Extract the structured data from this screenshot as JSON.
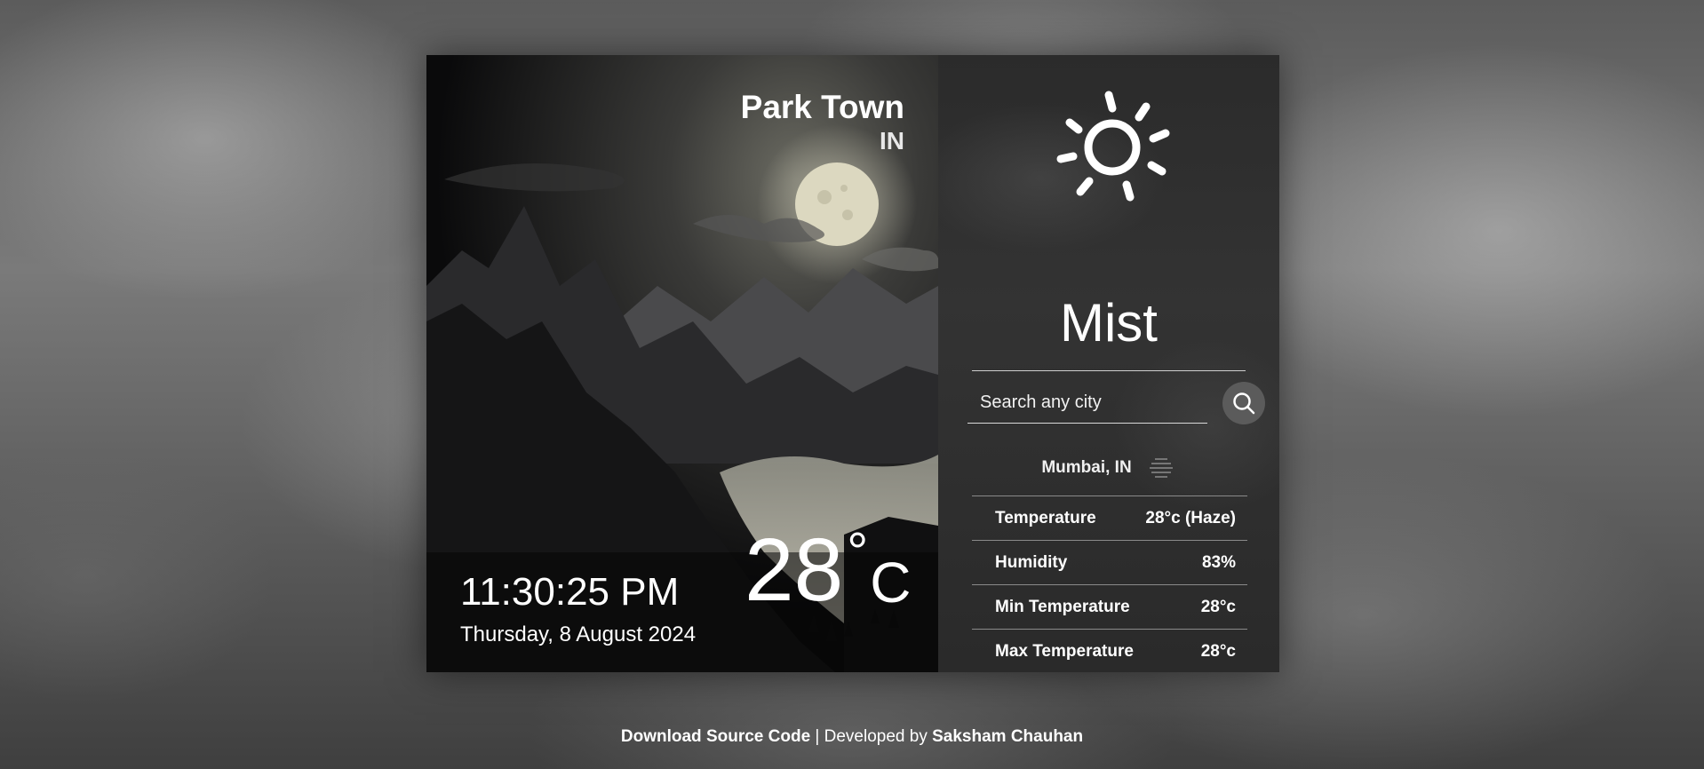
{
  "location": {
    "city": "Park Town",
    "country": "IN"
  },
  "clock": {
    "time": "11:30:25 PM",
    "date": "Thursday, 8 August 2024"
  },
  "current": {
    "temperature": "28",
    "degree_symbol": "°",
    "unit": "C"
  },
  "weather": {
    "icon": "sun-icon",
    "condition": "Mist"
  },
  "search": {
    "placeholder": "Search any city",
    "value": "",
    "button_icon": "search-icon"
  },
  "result": {
    "location": "Mumbai, IN",
    "icon": "haze-icon"
  },
  "details": [
    {
      "label": "Temperature",
      "value": "28°c (Haze)"
    },
    {
      "label": "Humidity",
      "value": "83%"
    },
    {
      "label": "Min Temperature",
      "value": "28°c"
    },
    {
      "label": "Max Temperature",
      "value": "28°c"
    }
  ],
  "footer": {
    "download_link": "Download Source Code",
    "separator": " | Developed by ",
    "author_link": "Saksham Chauhan"
  },
  "colors": {
    "panel_dark": "#0b0b0c",
    "panel_right": "#2b2b2b",
    "search_button": "#5b5b5b",
    "text": "#ffffff"
  }
}
